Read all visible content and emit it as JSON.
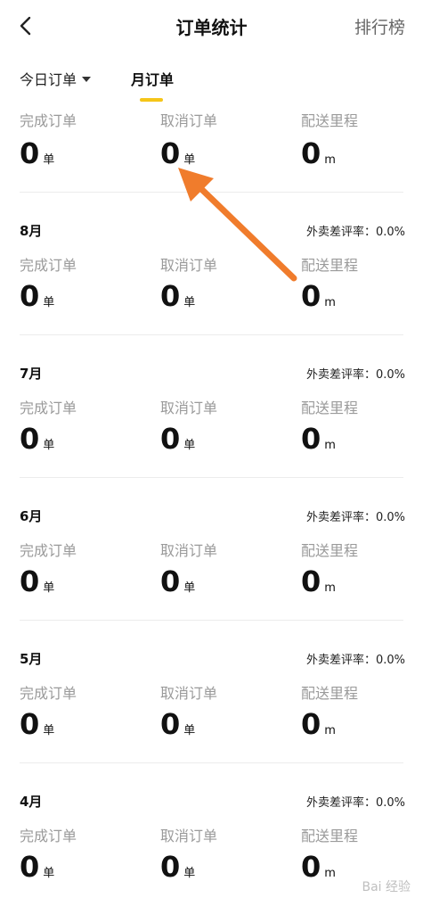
{
  "header": {
    "title": "订单统计",
    "rank_label": "排行榜"
  },
  "tabs": {
    "today": "今日订单",
    "month": "月订单"
  },
  "labels": {
    "completed": "完成订单",
    "cancelled": "取消订单",
    "distance": "配送里程",
    "unit_order": "单",
    "unit_distance": "m"
  },
  "current": {
    "completed": "0",
    "cancelled": "0",
    "distance": "0"
  },
  "months": [
    {
      "name": "8月",
      "bad_rate": "外卖差评率：0.0%",
      "completed": "0",
      "cancelled": "0",
      "distance": "0"
    },
    {
      "name": "7月",
      "bad_rate": "外卖差评率：0.0%",
      "completed": "0",
      "cancelled": "0",
      "distance": "0"
    },
    {
      "name": "6月",
      "bad_rate": "外卖差评率：0.0%",
      "completed": "0",
      "cancelled": "0",
      "distance": "0"
    },
    {
      "name": "5月",
      "bad_rate": "外卖差评率：0.0%",
      "completed": "0",
      "cancelled": "0",
      "distance": "0"
    },
    {
      "name": "4月",
      "bad_rate": "外卖差评率：0.0%",
      "completed": "0",
      "cancelled": "0",
      "distance": "0"
    }
  ],
  "colors": {
    "accent": "#f5c518",
    "annotation_arrow": "#f07c2c"
  },
  "watermark": "Bai 经验"
}
